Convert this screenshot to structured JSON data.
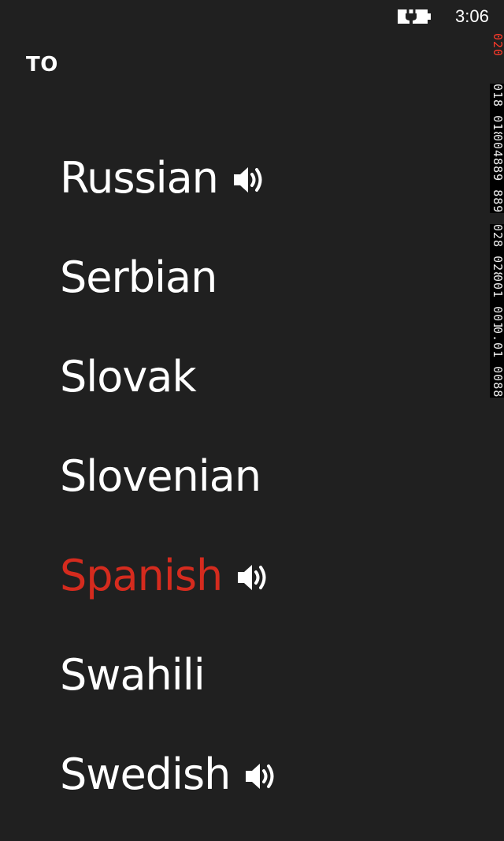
{
  "status_bar": {
    "time": "3:06",
    "battery_icon": "battery-charging-icon"
  },
  "header": {
    "title": "TO"
  },
  "languages": [
    {
      "label": "Russian",
      "speaker": true,
      "selected": false
    },
    {
      "label": "Serbian",
      "speaker": false,
      "selected": false
    },
    {
      "label": "Slovak",
      "speaker": false,
      "selected": false
    },
    {
      "label": "Slovenian",
      "speaker": false,
      "selected": false
    },
    {
      "label": "Spanish",
      "speaker": true,
      "selected": true
    },
    {
      "label": "Swahili",
      "speaker": false,
      "selected": false
    },
    {
      "label": "Swedish",
      "speaker": true,
      "selected": false
    }
  ],
  "debug_counters": [
    {
      "text": "020",
      "color": "#ff3a2a"
    },
    {
      "text": "018 018",
      "color": "#f0f0f0"
    },
    {
      "text": "004889 889",
      "color": "#f0f0f0"
    },
    {
      "text": "028 028",
      "color": "#f0f0f0"
    },
    {
      "text": "001 001",
      "color": "#f0f0f0"
    },
    {
      "text": "0.01 0088",
      "color": "#f0f0f0"
    }
  ],
  "colors": {
    "background": "#202020",
    "accent": "#d52b1e",
    "text": "#ffffff"
  }
}
